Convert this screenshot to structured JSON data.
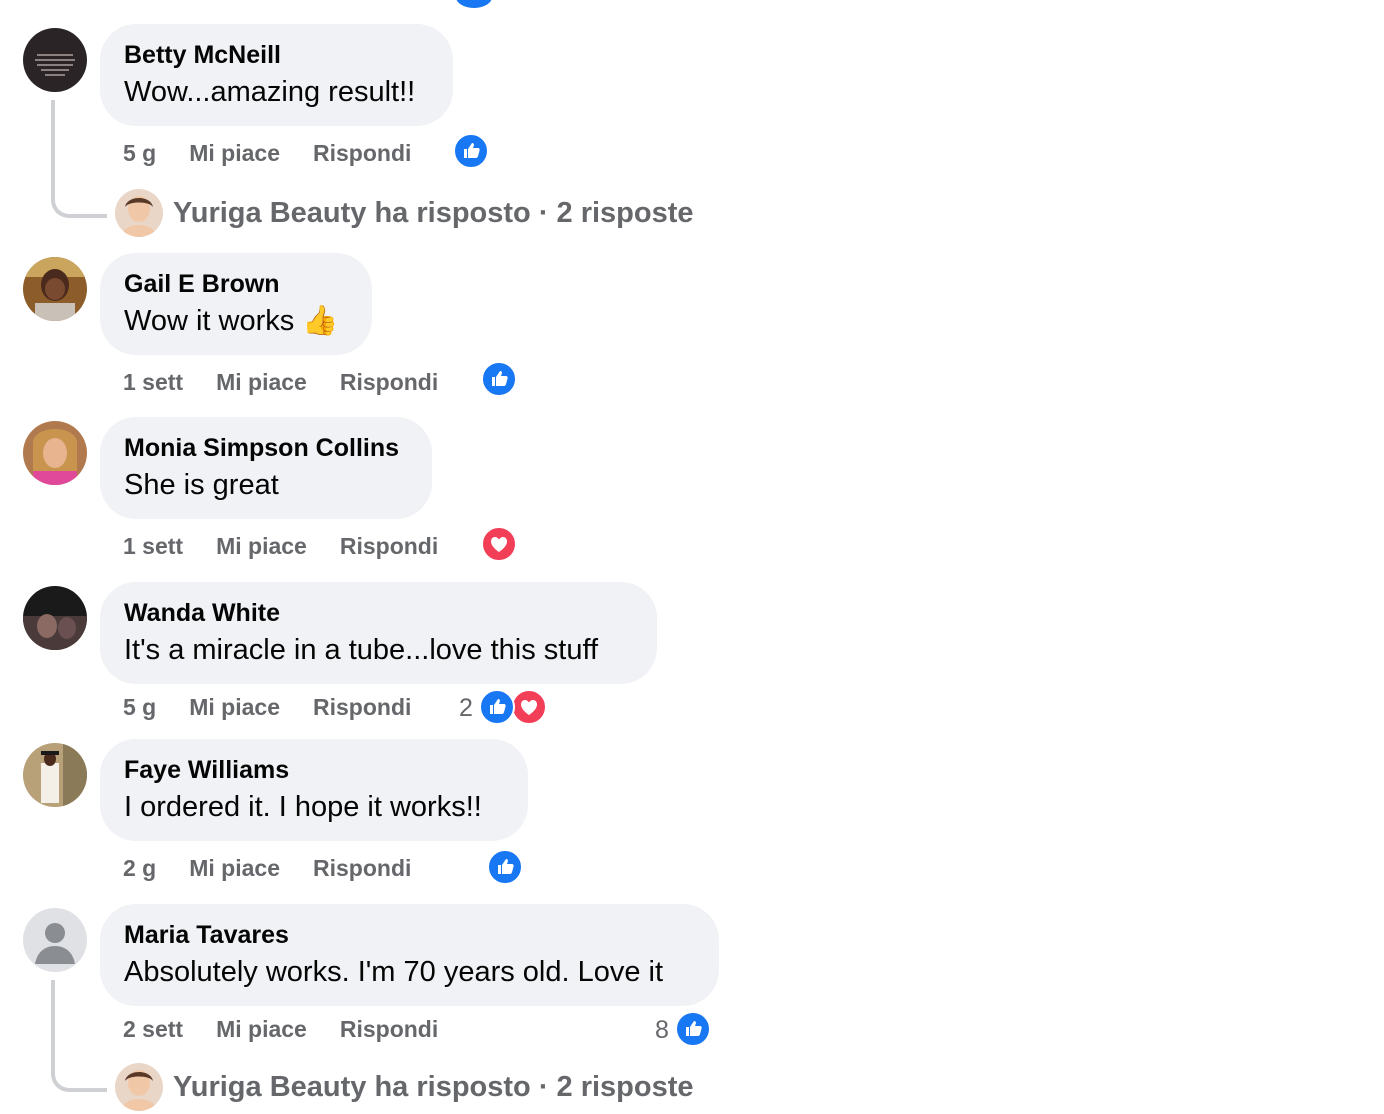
{
  "colors": {
    "like": "#1877f2",
    "love": "#f33e58",
    "bubble": "#f0f2f5",
    "meta": "#65676b"
  },
  "comments": [
    {
      "author": "Betty McNeill",
      "text": "Wow...amazing result!!",
      "time": "5 g",
      "like": "Mi piace",
      "reply": "Rispondi",
      "reactions": [
        "like"
      ],
      "count": ""
    },
    {
      "author": "Gail E Brown",
      "text": "Wow it works 👍",
      "time": "1 sett",
      "like": "Mi piace",
      "reply": "Rispondi",
      "reactions": [
        "like"
      ],
      "count": ""
    },
    {
      "author": "Monia Simpson Collins",
      "text": "She is great",
      "time": "1 sett",
      "like": "Mi piace",
      "reply": "Rispondi",
      "reactions": [
        "love"
      ],
      "count": ""
    },
    {
      "author": "Wanda White",
      "text": "It's a miracle in a tube...love this stuff",
      "time": "5 g",
      "like": "Mi piace",
      "reply": "Rispondi",
      "reactions": [
        "like",
        "love"
      ],
      "count": "2"
    },
    {
      "author": "Faye Williams",
      "text": "I ordered it. I hope it works!!",
      "time": "2 g",
      "like": "Mi piace",
      "reply": "Rispondi",
      "reactions": [
        "like"
      ],
      "count": ""
    },
    {
      "author": "Maria Tavares",
      "text": "Absolutely works. I'm 70 years old. Love it",
      "time": "2 sett",
      "like": "Mi piace",
      "reply": "Rispondi",
      "reactions": [
        "like"
      ],
      "count": "8"
    }
  ],
  "replies": [
    {
      "text": "Yuriga Beauty ha risposto · 2 risposte"
    },
    {
      "text": "Yuriga Beauty ha risposto · 2 risposte"
    }
  ]
}
